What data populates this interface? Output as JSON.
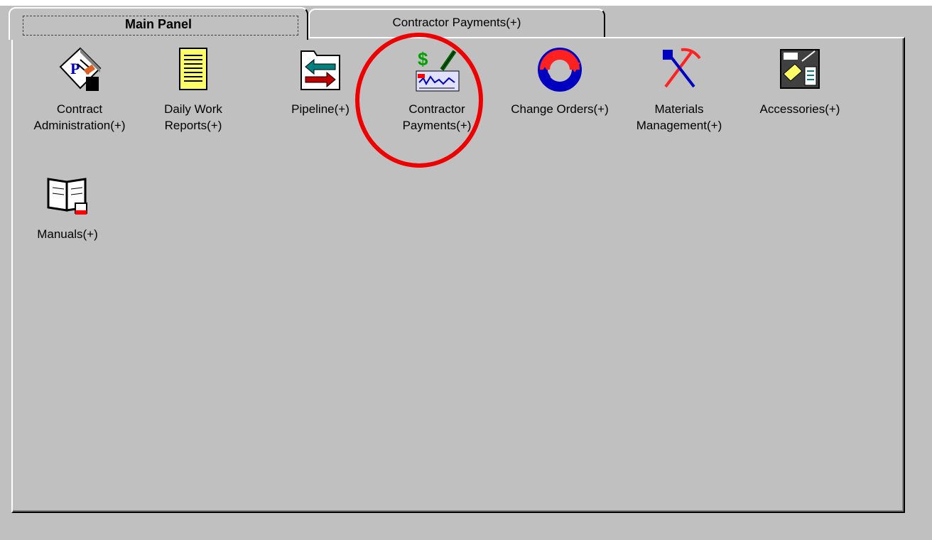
{
  "tabs": [
    {
      "label": "Main Panel",
      "active": true
    },
    {
      "label": "Contractor Payments(+)",
      "active": false
    }
  ],
  "items": [
    {
      "label": "Contract\nAdministration(+)",
      "icon": "contract-document-icon"
    },
    {
      "label": "Daily Work\nReports(+)",
      "icon": "notepad-icon"
    },
    {
      "label": "Pipeline(+)",
      "icon": "pipeline-folder-icon"
    },
    {
      "label": "Contractor\nPayments(+)",
      "icon": "dollar-check-icon"
    },
    {
      "label": "Change Orders(+)",
      "icon": "cycle-arrows-icon"
    },
    {
      "label": "Materials\nManagement(+)",
      "icon": "shovel-pickaxe-icon"
    },
    {
      "label": "Accessories(+)",
      "icon": "accessories-icon"
    },
    {
      "label": "Manuals(+)",
      "icon": "open-book-icon"
    }
  ],
  "annotation": {
    "shape": "circle",
    "color": "#ee0000"
  }
}
